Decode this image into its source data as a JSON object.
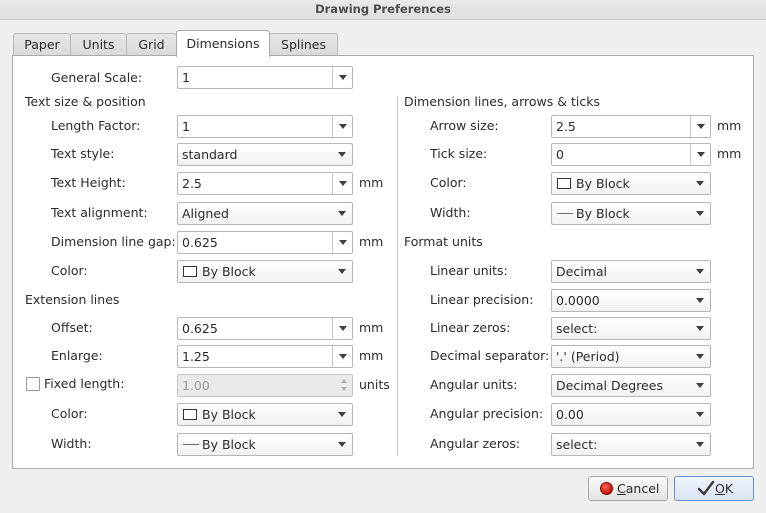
{
  "window": {
    "title": "Drawing Preferences"
  },
  "tabs": [
    {
      "label": "Paper"
    },
    {
      "label": "Units"
    },
    {
      "label": "Grid"
    },
    {
      "label": "Dimensions"
    },
    {
      "label": "Splines"
    }
  ],
  "active_tab": "Dimensions",
  "general_scale": {
    "label": "General Scale:",
    "value": "1"
  },
  "text_section": {
    "heading": "Text size & position",
    "length_factor": {
      "label": "Length Factor:",
      "value": "1"
    },
    "text_style": {
      "label": "Text style:",
      "value": "standard"
    },
    "text_height": {
      "label": "Text Height:",
      "value": "2.5",
      "unit": "mm"
    },
    "text_alignment": {
      "label": "Text alignment:",
      "value": "Aligned"
    },
    "dim_line_gap": {
      "label": "Dimension line gap:",
      "value": "0.625",
      "unit": "mm"
    },
    "color": {
      "label": "Color:",
      "value": "By Block"
    }
  },
  "extension_section": {
    "heading": "Extension lines",
    "offset": {
      "label": "Offset:",
      "value": "0.625",
      "unit": "mm"
    },
    "enlarge": {
      "label": "Enlarge:",
      "value": "1.25",
      "unit": "mm"
    },
    "fixed_length": {
      "label": "Fixed length:",
      "value": "1.00",
      "unit": "units",
      "checked": false,
      "enabled": false
    },
    "color": {
      "label": "Color:",
      "value": "By Block"
    },
    "width": {
      "label": "Width:",
      "value": "By Block"
    }
  },
  "dimlines_section": {
    "heading": "Dimension lines, arrows & ticks",
    "arrow_size": {
      "label": "Arrow size:",
      "value": "2.5",
      "unit": "mm"
    },
    "tick_size": {
      "label": "Tick size:",
      "value": "0",
      "unit": "mm"
    },
    "color": {
      "label": "Color:",
      "value": "By Block"
    },
    "width": {
      "label": "Width:",
      "value": "By Block"
    }
  },
  "format_section": {
    "heading": "Format units",
    "linear_units": {
      "label": "Linear units:",
      "value": "Decimal"
    },
    "linear_precision": {
      "label": "Linear precision:",
      "value": "0.0000"
    },
    "linear_zeros": {
      "label": "Linear zeros:",
      "value": "select:"
    },
    "decimal_separator": {
      "label": "Decimal separator:",
      "value": "'.' (Period)"
    },
    "angular_units": {
      "label": "Angular units:",
      "value": "Decimal Degrees"
    },
    "angular_precision": {
      "label": "Angular precision:",
      "value": "0.00"
    },
    "angular_zeros": {
      "label": "Angular zeros:",
      "value": "select:"
    }
  },
  "buttons": {
    "cancel": {
      "mnemonic": "C",
      "rest": "ancel"
    },
    "ok": {
      "mnemonic": "O",
      "rest": "K"
    }
  },
  "colors": {
    "cancel_icon": "#d0140c",
    "default_button_border": "#6b8fc7"
  },
  "icons": {
    "cancel": "stop-circle-icon",
    "ok": "checkmark-icon"
  }
}
